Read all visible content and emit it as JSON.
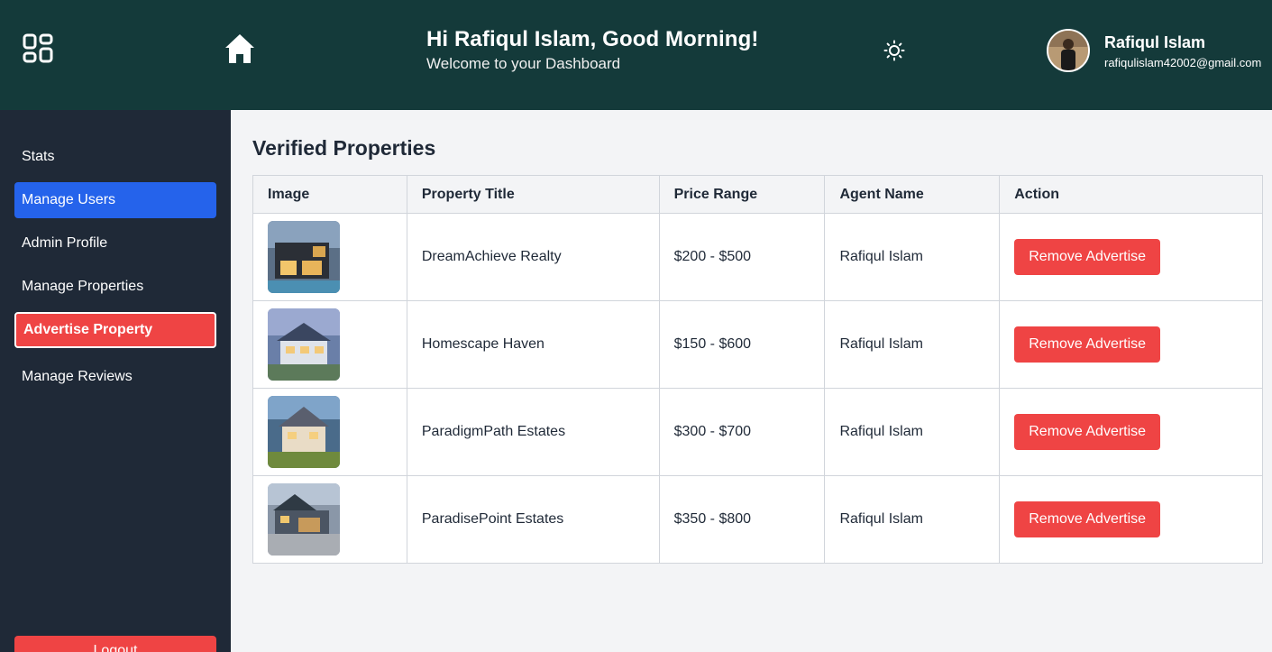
{
  "header": {
    "greeting_title": "Hi Rafiqul Islam, Good Morning!",
    "greeting_subtitle": "Welcome to your Dashboard",
    "user_name": "Rafiqul Islam",
    "user_email": "rafiqulislam42002@gmail.com",
    "icons": [
      "dashboard-grid-icon",
      "home-icon",
      "sun-icon"
    ]
  },
  "sidebar": {
    "items": [
      {
        "label": "Stats"
      },
      {
        "label": "Manage Users"
      },
      {
        "label": "Admin Profile"
      },
      {
        "label": "Manage Properties"
      },
      {
        "label": "Advertise Property"
      },
      {
        "label": "Manage Reviews"
      }
    ],
    "logout_label": "Logout"
  },
  "main": {
    "title": "Verified Properties",
    "columns": [
      "Image",
      "Property Title",
      "Price Range",
      "Agent Name",
      "Action"
    ],
    "rows": [
      {
        "title": "DreamAchieve Realty",
        "price": "$200 - $500",
        "agent": "Rafiqul Islam",
        "action": "Remove Advertise"
      },
      {
        "title": "Homescape Haven",
        "price": "$150 - $600",
        "agent": "Rafiqul Islam",
        "action": "Remove Advertise"
      },
      {
        "title": "ParadigmPath Estates",
        "price": "$300 - $700",
        "agent": "Rafiqul Islam",
        "action": "Remove Advertise"
      },
      {
        "title": "ParadisePoint Estates",
        "price": "$350 - $800",
        "agent": "Rafiqul Islam",
        "action": "Remove Advertise"
      }
    ]
  },
  "colors": {
    "header_bg": "#143a3a",
    "sidebar_bg": "#1f2937",
    "active_blue": "#2563eb",
    "danger_red": "#ef4444"
  }
}
